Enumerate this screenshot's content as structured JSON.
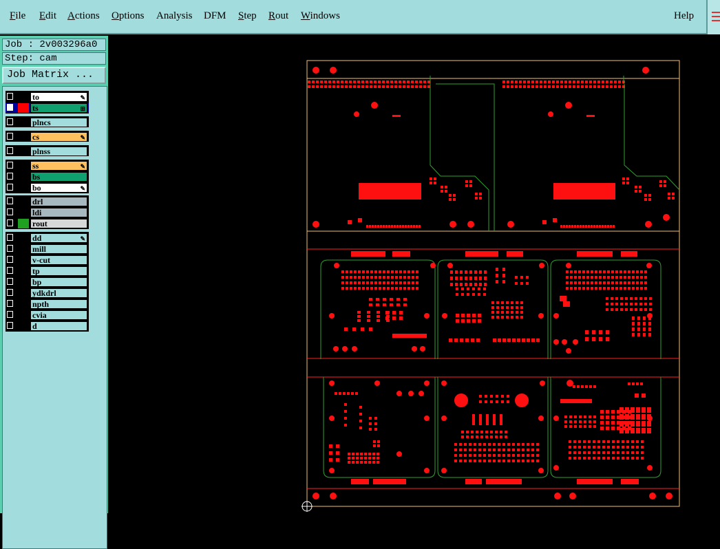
{
  "menu": {
    "items": [
      {
        "label": "File",
        "ul": "F",
        "rest": "ile"
      },
      {
        "label": "Edit",
        "ul": "E",
        "rest": "dit"
      },
      {
        "label": "Actions",
        "ul": "A",
        "rest": "ctions"
      },
      {
        "label": "Options",
        "ul": "O",
        "rest": "ptions"
      },
      {
        "label": "Analysis",
        "ul": "",
        "rest": "Analysis"
      },
      {
        "label": "DFM",
        "ul": "",
        "rest": "DFM"
      },
      {
        "label": "Step",
        "ul": "S",
        "rest": "tep"
      },
      {
        "label": "Rout",
        "ul": "R",
        "rest": "out"
      },
      {
        "label": "Windows",
        "ul": "W",
        "rest": "indows"
      }
    ],
    "help": "Help"
  },
  "job": {
    "job_line": "Job : 2v003296a0",
    "step_line": "Step: cam",
    "matrix_button": "Job Matrix ..."
  },
  "layers": [
    {
      "name": "to",
      "color": "#000000",
      "bg": "#ffffff",
      "mark": "pen-icon"
    },
    {
      "name": "ts",
      "color": "#ff0000",
      "bg": "#10a070",
      "mark": "grid-icon",
      "selected": true
    },
    {
      "name": "plncs",
      "color": "#000000",
      "bg": "#a2dcdc"
    },
    {
      "name": "cs",
      "color": "#000000",
      "bg": "#ffc060",
      "mark": "pen-icon"
    },
    {
      "name": "plnss",
      "color": "#000000",
      "bg": "#a2dcdc"
    },
    {
      "name": "ss",
      "color": "#000000",
      "bg": "#ffc060",
      "mark": "pen-icon"
    },
    {
      "name": "bs",
      "color": "#000000",
      "bg": "#10a070"
    },
    {
      "name": "bo",
      "color": "#000000",
      "bg": "#ffffff",
      "mark": "pen-icon"
    },
    {
      "name": "drl",
      "color": "#000000",
      "bg": "#a8b8c0"
    },
    {
      "name": "ldi",
      "color": "#000000",
      "bg": "#a8b8c0"
    },
    {
      "name": "rout",
      "color": "#20a020",
      "bg": "#d8d8d8"
    },
    {
      "name": "dd",
      "color": "#000000",
      "bg": "#a2dcdc",
      "mark": "pen-icon"
    },
    {
      "name": "mill",
      "color": "#000000",
      "bg": "#a2dcdc"
    },
    {
      "name": "v-cut",
      "color": "#000000",
      "bg": "#a2dcdc"
    },
    {
      "name": "tp",
      "color": "#000000",
      "bg": "#a2dcdc"
    },
    {
      "name": "bp",
      "color": "#000000",
      "bg": "#a2dcdc"
    },
    {
      "name": "ydkdrl",
      "color": "#000000",
      "bg": "#a2dcdc"
    },
    {
      "name": "npth",
      "color": "#000000",
      "bg": "#a2dcdc"
    },
    {
      "name": "cvia",
      "color": "#000000",
      "bg": "#a2dcdc"
    },
    {
      "name": "d",
      "color": "#000000",
      "bg": "#a2dcdc"
    }
  ],
  "colors": {
    "pad": "#ff1010",
    "outline": "#f2c070",
    "rout": "#30a030",
    "vcut": "#ff2020"
  }
}
